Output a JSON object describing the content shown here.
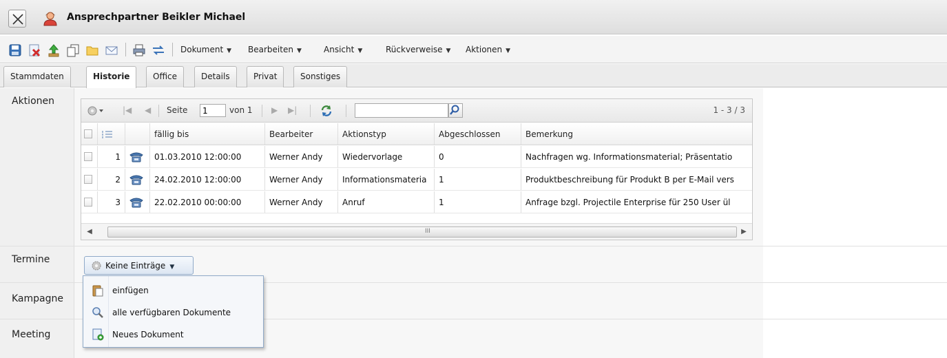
{
  "window": {
    "title": "Ansprechpartner Beikler Michael"
  },
  "toolbar": {
    "icons": [
      "save-icon",
      "delete-icon",
      "upload-icon",
      "copy-icon",
      "folder-icon",
      "mail-icon",
      "print-icon",
      "transfer-icon"
    ],
    "menus": [
      "Dokument",
      "Bearbeiten",
      "Ansicht",
      "Rückverweise",
      "Aktionen"
    ]
  },
  "tabs": [
    {
      "label": "Stammdaten",
      "active": false
    },
    {
      "label": "Historie",
      "active": true
    },
    {
      "label": "Office",
      "active": false
    },
    {
      "label": "Details",
      "active": false
    },
    {
      "label": "Privat",
      "active": false
    },
    {
      "label": "Sonstiges",
      "active": false
    }
  ],
  "sections": {
    "aktionen": "Aktionen",
    "termine": "Termine",
    "kampagne": "Kampagne",
    "meeting": "Meeting"
  },
  "pager": {
    "page_label": "Seite",
    "page_value": "1",
    "of_label": "von 1",
    "count": "1 - 3 / 3",
    "search_value": ""
  },
  "grid": {
    "columns": [
      "fällig bis",
      "Bearbeiter",
      "Aktionstyp",
      "Abgeschlossen",
      "Bemerkung"
    ],
    "rows": [
      {
        "num": "1",
        "faellig": "01.03.2010 12:00:00",
        "bearbeiter": "Werner Andy",
        "typ": "Wiedervorlage",
        "abgeschlossen": "0",
        "bemerkung": "Nachfragen wg. Informationsmaterial; Präsentatio"
      },
      {
        "num": "2",
        "faellig": "24.02.2010 12:00:00",
        "bearbeiter": "Werner Andy",
        "typ": "Informationsmateria",
        "abgeschlossen": "1",
        "bemerkung": "Produktbeschreibung für Produkt B per E-Mail vers"
      },
      {
        "num": "3",
        "faellig": "22.02.2010 00:00:00",
        "bearbeiter": "Werner Andy",
        "typ": "Anruf",
        "abgeschlossen": "1",
        "bemerkung": "Anfrage bzgl. Projectile Enterprise für 250 User ül"
      }
    ],
    "scroll_grip": "III"
  },
  "termine": {
    "button_label": "Keine Einträge",
    "menu": [
      {
        "label": "einfügen",
        "icon": "paste-icon"
      },
      {
        "label": "alle verfügbaren Dokumente",
        "icon": "magnifier-icon"
      },
      {
        "label": "Neues Dokument",
        "icon": "new-document-icon"
      }
    ]
  }
}
